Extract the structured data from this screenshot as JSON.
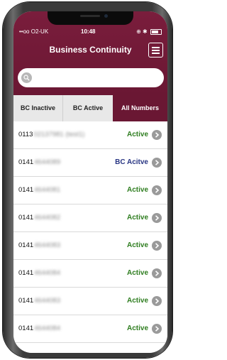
{
  "status_bar": {
    "carrier": "••oo O2-UK",
    "time": "10:48",
    "right_icons": "⊕ ✱"
  },
  "header": {
    "title": "Business Continuity",
    "menu_icon": "hamburger-icon"
  },
  "search": {
    "placeholder": "",
    "value": "",
    "icon": "search-icon"
  },
  "tabs": [
    {
      "label": "BC Inactive",
      "selected": false
    },
    {
      "label": "BC Active",
      "selected": false
    },
    {
      "label": "All Numbers",
      "selected": true
    }
  ],
  "rows": [
    {
      "prefix": "0113",
      "hidden": "02137981 (test1)",
      "status": "Active"
    },
    {
      "prefix": "0141",
      "hidden": "4644089",
      "status": "BC Acitve"
    },
    {
      "prefix": "0141",
      "hidden": "4644081",
      "status": "Active"
    },
    {
      "prefix": "0141",
      "hidden": "4644082",
      "status": "Active"
    },
    {
      "prefix": "0141",
      "hidden": "4644083",
      "status": "Active"
    },
    {
      "prefix": "0141",
      "hidden": "4644084",
      "status": "Active"
    },
    {
      "prefix": "0141",
      "hidden": "4644083",
      "status": "Active"
    },
    {
      "prefix": "0141",
      "hidden": "4644084",
      "status": "Active"
    }
  ],
  "colors": {
    "brand": "#6a1733",
    "active": "#2e7d1f",
    "bc_active": "#283583"
  }
}
